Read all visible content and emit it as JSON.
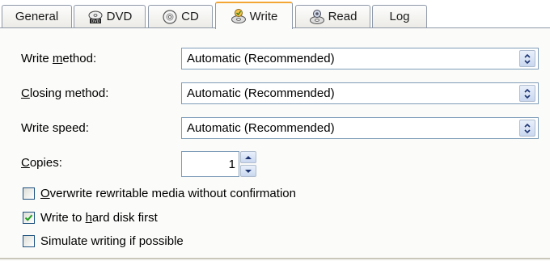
{
  "tabs": [
    {
      "label": "General",
      "icon": "none"
    },
    {
      "label": "DVD",
      "icon": "dvd-disc-icon"
    },
    {
      "label": "CD",
      "icon": "cd-disc-icon"
    },
    {
      "label": "Write",
      "icon": "write-disc-icon",
      "active": true
    },
    {
      "label": "Read",
      "icon": "read-disc-icon"
    },
    {
      "label": "Log",
      "icon": "none"
    }
  ],
  "write_method": {
    "label_pre": "Write ",
    "label_ul": "m",
    "label_post": "ethod:",
    "value": "Automatic (Recommended)"
  },
  "closing_method": {
    "label_pre": "",
    "label_ul": "C",
    "label_post": "losing method:",
    "value": "Automatic (Recommended)"
  },
  "write_speed": {
    "label": "Write speed:",
    "value": "Automatic (Recommended)"
  },
  "copies": {
    "label_ul": "C",
    "label_post": "opies:",
    "value": "1"
  },
  "options": [
    {
      "pre": "",
      "ul": "O",
      "post": "verwrite rewritable media without confirmation",
      "checked": false
    },
    {
      "pre": "Write to ",
      "ul": "h",
      "post": "ard disk first",
      "checked": true
    },
    {
      "pre": "Simulate writing if possible",
      "ul": "",
      "post": "",
      "checked": false
    }
  ],
  "colors": {
    "accent_tab": "#f3a633",
    "control_border": "#7f9db9",
    "check_mark": "#21a121"
  }
}
